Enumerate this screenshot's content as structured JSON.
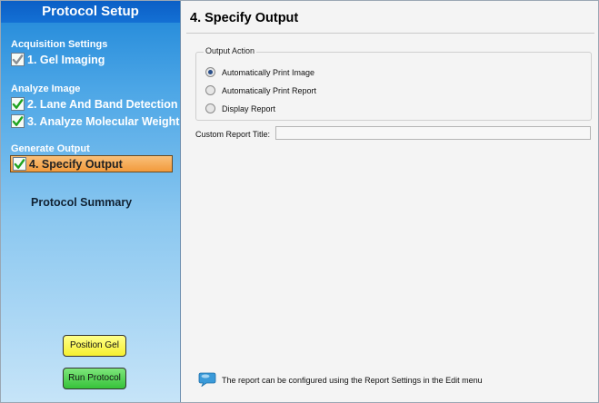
{
  "sidebar": {
    "title": "Protocol Setup",
    "sections": [
      {
        "label": "Acquisition Settings"
      },
      {
        "label": "Analyze Image"
      },
      {
        "label": "Generate Output"
      }
    ],
    "steps": [
      {
        "label": "1. Gel Imaging",
        "checked": true
      },
      {
        "label": "2. Lane And Band Detection",
        "checked": true
      },
      {
        "label": "3. Analyze Molecular Weight",
        "checked": true
      },
      {
        "label": "4. Specify Output",
        "checked": true,
        "active": true
      }
    ],
    "summary_label": "Protocol Summary",
    "position_gel_label": "Position Gel",
    "run_protocol_label": "Run Protocol"
  },
  "main": {
    "title": "4. Specify Output",
    "output_action": {
      "legend": "Output Action",
      "options": [
        {
          "label": "Automatically Print Image",
          "selected": true
        },
        {
          "label": "Automatically Print Report",
          "selected": false
        },
        {
          "label": "Display Report",
          "selected": false
        }
      ]
    },
    "custom_report_title": {
      "label": "Custom Report Title:",
      "value": ""
    },
    "info_text": "The report can be configured using the Report Settings in the Edit menu"
  },
  "colors": {
    "sidebar_top": "#1e86d8",
    "sidebar_bottom": "#c6e4f8",
    "active_step": "#f29a3c",
    "position_gel_button": "#f5ef30",
    "run_protocol_button": "#36c23a"
  }
}
